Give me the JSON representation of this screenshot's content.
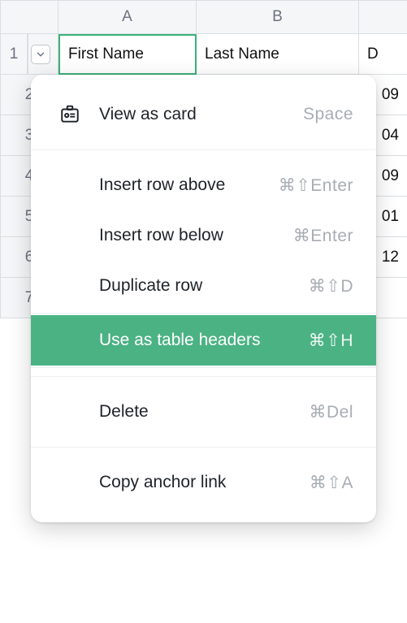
{
  "columns": [
    "A",
    "B"
  ],
  "partial_column": "D",
  "rows": [
    1,
    2,
    3,
    4,
    5,
    6,
    7
  ],
  "cells": {
    "A1": "First Name",
    "B1": "Last Name",
    "C2": "09",
    "C3": "04",
    "C4": "09",
    "C5": "01",
    "C6": "12"
  },
  "menu": {
    "view_as_card": {
      "label": "View as card",
      "shortcut": "Space"
    },
    "insert_above": {
      "label": "Insert row above",
      "shortcut": "⌘⇧Enter"
    },
    "insert_below": {
      "label": "Insert row below",
      "shortcut": "⌘Enter"
    },
    "duplicate": {
      "label": "Duplicate row",
      "shortcut": "⌘⇧D"
    },
    "use_headers": {
      "label": "Use as table headers",
      "shortcut": "⌘⇧H"
    },
    "delete": {
      "label": "Delete",
      "shortcut": "⌘Del"
    },
    "copy_anchor": {
      "label": "Copy anchor link",
      "shortcut": "⌘⇧A"
    }
  }
}
